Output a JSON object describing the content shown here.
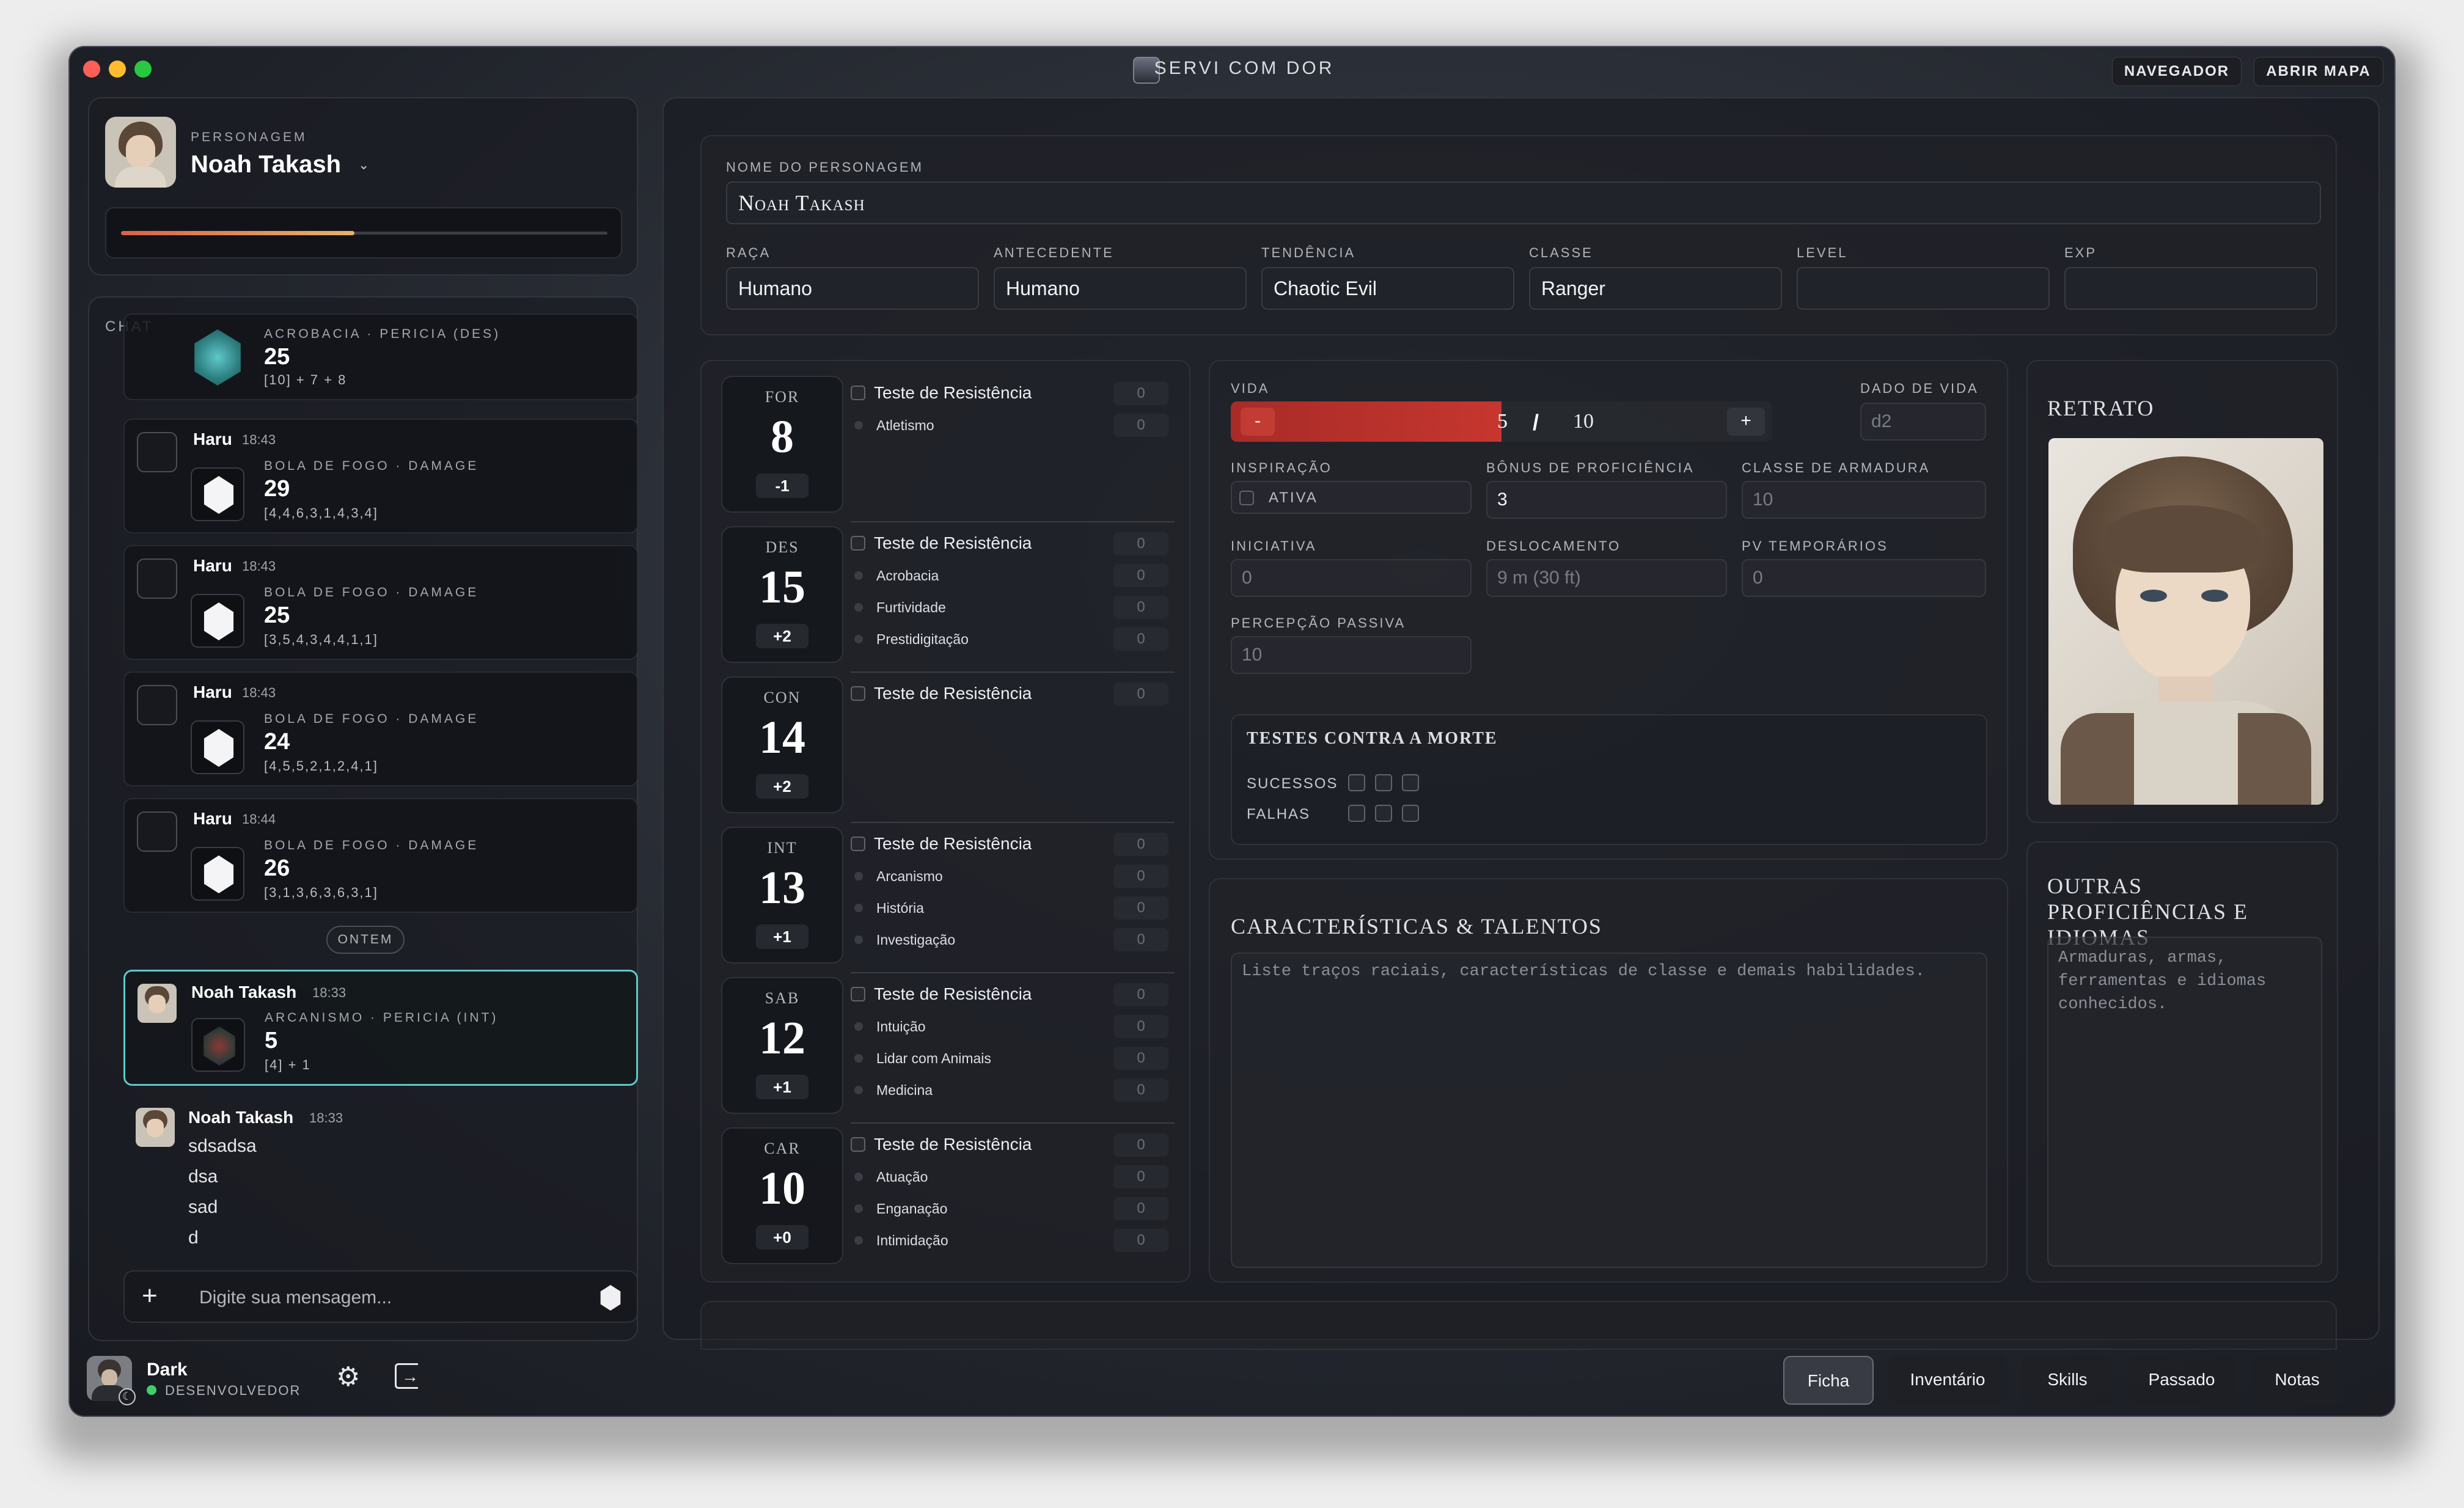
{
  "window": {
    "title": "SERVI COM DOR",
    "buttons": [
      "NAVEGADOR",
      "ABRIR MAPA"
    ]
  },
  "character": {
    "caption": "PERSONAGEM",
    "name": "Noah Takash",
    "hp_fraction": 0.48
  },
  "chat": {
    "label": "CHAT",
    "messages": [
      {
        "user": "",
        "time": "",
        "title": "ACROBACIA · PERICIA (DES)",
        "total": "25",
        "detail": "[10] + 7 + 8"
      },
      {
        "user": "Haru",
        "time": "18:43",
        "title": "BOLA DE FOGO · DAMAGE",
        "total": "29",
        "detail": "[4,4,6,3,1,4,3,4]"
      },
      {
        "user": "Haru",
        "time": "18:43",
        "title": "BOLA DE FOGO · DAMAGE",
        "total": "25",
        "detail": "[3,5,4,3,4,4,1,1]"
      },
      {
        "user": "Haru",
        "time": "18:43",
        "title": "BOLA DE FOGO · DAMAGE",
        "total": "24",
        "detail": "[4,5,5,2,1,2,4,1]"
      },
      {
        "user": "Haru",
        "time": "18:44",
        "title": "BOLA DE FOGO · DAMAGE",
        "total": "26",
        "detail": "[3,1,3,6,3,6,3,1]"
      }
    ],
    "day_divider": "ONTEM",
    "highlight": {
      "user": "Noah Takash",
      "time": "18:33",
      "title": "ARCANISMO · PERICIA (INT)",
      "total": "5",
      "detail": "[4] + 1"
    },
    "text_msg": {
      "user": "Noah Takash",
      "time": "18:33",
      "lines": [
        "sdsadsa",
        "dsa",
        "sad",
        "d"
      ]
    },
    "input_placeholder": "Digite sua mensagem..."
  },
  "user": {
    "name": "Dark",
    "role": "DESENVOLVEDOR"
  },
  "sheet": {
    "name_label": "NOME DO PERSONAGEM",
    "name_value": "Noah Takash",
    "fields": [
      {
        "label": "RAÇA",
        "value": "Humano"
      },
      {
        "label": "ANTECEDENTE",
        "value": "Humano"
      },
      {
        "label": "TENDÊNCIA",
        "value": "Chaotic Evil"
      },
      {
        "label": "CLASSE",
        "value": "Ranger"
      },
      {
        "label": "LEVEL",
        "value": ""
      },
      {
        "label": "EXP",
        "value": ""
      }
    ],
    "abilities": [
      {
        "abbr": "FOR",
        "score": "8",
        "mod": "-1",
        "save": "Teste de Resistência",
        "save_val": "0",
        "skills": [
          {
            "name": "Atletismo",
            "val": "0"
          }
        ]
      },
      {
        "abbr": "DES",
        "score": "15",
        "mod": "+2",
        "save": "Teste de Resistência",
        "save_val": "0",
        "skills": [
          {
            "name": "Acrobacia",
            "val": "0"
          },
          {
            "name": "Furtividade",
            "val": "0"
          },
          {
            "name": "Prestidigitação",
            "val": "0"
          }
        ]
      },
      {
        "abbr": "CON",
        "score": "14",
        "mod": "+2",
        "save": "Teste de Resistência",
        "save_val": "0",
        "skills": []
      },
      {
        "abbr": "INT",
        "score": "13",
        "mod": "+1",
        "save": "Teste de Resistência",
        "save_val": "0",
        "skills": [
          {
            "name": "Arcanismo",
            "val": "0"
          },
          {
            "name": "História",
            "val": "0"
          },
          {
            "name": "Investigação",
            "val": "0"
          }
        ]
      },
      {
        "abbr": "SAB",
        "score": "12",
        "mod": "+1",
        "save": "Teste de Resistência",
        "save_val": "0",
        "skills": [
          {
            "name": "Intuição",
            "val": "0"
          },
          {
            "name": "Lidar com Animais",
            "val": "0"
          },
          {
            "name": "Medicina",
            "val": "0"
          }
        ]
      },
      {
        "abbr": "CAR",
        "score": "10",
        "mod": "+0",
        "save": "Teste de Resistência",
        "save_val": "0",
        "skills": [
          {
            "name": "Atuação",
            "val": "0"
          },
          {
            "name": "Enganação",
            "val": "0"
          },
          {
            "name": "Intimidação",
            "val": "0"
          }
        ]
      }
    ],
    "vida": {
      "label": "VIDA",
      "minus": "-",
      "current": "5",
      "sep": "/",
      "max": "10",
      "plus": "+",
      "fraction": 0.5
    },
    "dado_vida": {
      "label": "DADO DE VIDA",
      "placeholder": "d2"
    },
    "inspiracao": {
      "label": "INSPIRAÇÃO",
      "text": "ATIVA"
    },
    "bonus_prof": {
      "label": "BÔNUS DE PROFICIÊNCIA",
      "value": "3"
    },
    "ca": {
      "label": "CLASSE DE ARMADURA",
      "placeholder": "10"
    },
    "iniciativa": {
      "label": "INICIATIVA",
      "placeholder": "0"
    },
    "deslocamento": {
      "label": "DESLOCAMENTO",
      "placeholder": "9 m (30 ft)"
    },
    "pv_temp": {
      "label": "PV TEMPORÁRIOS",
      "placeholder": "0"
    },
    "percepcao": {
      "label": "PERCEPÇÃO PASSIVA",
      "placeholder": "10"
    },
    "death": {
      "title": "TESTES CONTRA A MORTE",
      "successes": "SUCESSOS",
      "failures": "FALHAS"
    },
    "traits": {
      "title": "CARACTERÍSTICAS & TALENTOS",
      "placeholder": "Liste traços raciais, características de classe e demais habilidades."
    },
    "portrait": {
      "title": "RETRATO"
    },
    "other": {
      "title": "OUTRAS PROFICIÊNCIAS E IDIOMAS",
      "placeholder": "Armaduras, armas, ferramentas e idiomas conhecidos."
    }
  },
  "tabs": [
    "Ficha",
    "Inventário",
    "Skills",
    "Passado",
    "Notas"
  ],
  "colors": {
    "accent": "#c23b34",
    "hp_gradient_start": "#d96248",
    "hp_gradient_end": "#e6b36a",
    "teal": "#5fc8c9",
    "online": "#3ecf6b"
  }
}
